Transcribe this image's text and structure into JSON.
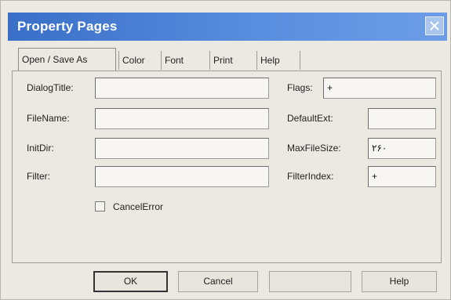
{
  "dialog": {
    "title": "Property Pages"
  },
  "tabs": [
    {
      "label": "Open / Save As"
    },
    {
      "label": "Color"
    },
    {
      "label": "Font"
    },
    {
      "label": "Print"
    },
    {
      "label": "Help"
    }
  ],
  "fields": {
    "dialog_title": {
      "label": "DialogTitle:",
      "value": ""
    },
    "file_name": {
      "label": "FileName:",
      "value": ""
    },
    "init_dir": {
      "label": "InitDir:",
      "value": ""
    },
    "filter": {
      "label": "Filter:",
      "value": ""
    },
    "flags": {
      "label": "Flags:",
      "value": "+"
    },
    "default_ext": {
      "label": "DefaultExt:",
      "value": ""
    },
    "max_file_size": {
      "label": "MaxFileSize:",
      "value": "۲۶۰"
    },
    "filter_index": {
      "label": "FilterIndex:",
      "value": "+"
    }
  },
  "checkbox": {
    "label": "CancelError",
    "checked": false
  },
  "buttons": {
    "ok": "OK",
    "cancel": "Cancel",
    "apply": "",
    "help": "Help"
  }
}
